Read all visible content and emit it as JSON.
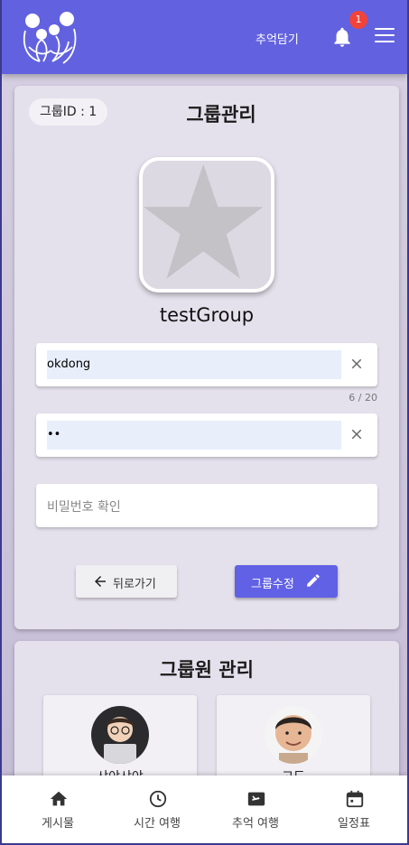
{
  "header": {
    "link_label": "추억담기",
    "notification_count": "1"
  },
  "group_card": {
    "group_id_label": "그룹ID : 1",
    "title": "그룹관리",
    "group_name": "testGroup",
    "name_field_value": "okdong",
    "name_counter": "6 / 20",
    "password_field_value": "••",
    "confirm_password_placeholder": "비밀번호 확인",
    "back_button_label": "뒤로가기",
    "edit_button_label": "그룹수정"
  },
  "members_card": {
    "title": "그룹원 관리",
    "members": [
      {
        "name": "샤야샤야"
      },
      {
        "name": "고도"
      }
    ]
  },
  "bottom_nav": {
    "items": [
      {
        "label": "게시물",
        "icon": "home-icon"
      },
      {
        "label": "시간 여행",
        "icon": "clock-icon"
      },
      {
        "label": "추억 여행",
        "icon": "travel-icon"
      },
      {
        "label": "일정표",
        "icon": "calendar-icon"
      }
    ]
  },
  "colors": {
    "header": "#6262e0",
    "edit_button": "#6161e6",
    "badge": "#f2433a"
  }
}
